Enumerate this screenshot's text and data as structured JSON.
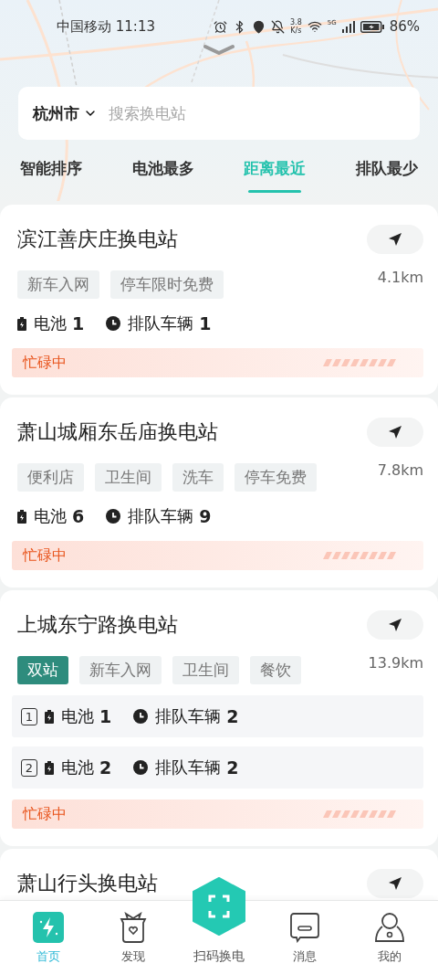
{
  "status_bar": {
    "carrier_time": "中国移动 11:13",
    "speed_value": "3.8",
    "speed_unit": "K/s",
    "network": "5G",
    "battery": "86%"
  },
  "search": {
    "city": "杭州市",
    "placeholder": "搜索换电站"
  },
  "sort_tabs": [
    {
      "label": "智能排序",
      "selected": false
    },
    {
      "label": "电池最多",
      "selected": false
    },
    {
      "label": "距离最近",
      "selected": true
    },
    {
      "label": "排队最少",
      "selected": false
    }
  ],
  "stations": [
    {
      "name": "滨江善庆庄换电站",
      "distance": "4.1km",
      "tags": [
        {
          "label": "新车入网",
          "kind": "normal"
        },
        {
          "label": "停车限时免费",
          "kind": "normal"
        }
      ],
      "bays": [
        {
          "battery_label": "电池",
          "battery_count": "1",
          "queue_label": "排队车辆",
          "queue_count": "1"
        }
      ],
      "status": "忙碌中"
    },
    {
      "name": "萧山城厢东岳庙换电站",
      "distance": "7.8km",
      "tags": [
        {
          "label": "便利店",
          "kind": "normal"
        },
        {
          "label": "卫生间",
          "kind": "normal"
        },
        {
          "label": "洗车",
          "kind": "normal"
        },
        {
          "label": "停车免费",
          "kind": "normal"
        }
      ],
      "bays": [
        {
          "battery_label": "电池",
          "battery_count": "6",
          "queue_label": "排队车辆",
          "queue_count": "9"
        }
      ],
      "status": "忙碌中"
    },
    {
      "name": "上城东宁路换电站",
      "distance": "13.9km",
      "tags": [
        {
          "label": "双站",
          "kind": "highlight"
        },
        {
          "label": "新车入网",
          "kind": "normal"
        },
        {
          "label": "卫生间",
          "kind": "normal"
        },
        {
          "label": "餐饮",
          "kind": "normal"
        }
      ],
      "bays": [
        {
          "index": "1",
          "battery_label": "电池",
          "battery_count": "1",
          "queue_label": "排队车辆",
          "queue_count": "2"
        },
        {
          "index": "2",
          "battery_label": "电池",
          "battery_count": "2",
          "queue_label": "排队车辆",
          "queue_count": "2"
        }
      ],
      "status": "忙碌中"
    },
    {
      "name": "萧山行头换电站"
    }
  ],
  "bottom_nav": [
    {
      "label": "首页",
      "kind": "home",
      "selected": true
    },
    {
      "label": "发现",
      "kind": "discover",
      "selected": false
    },
    {
      "label": "扫码换电",
      "kind": "scan",
      "selected": false
    },
    {
      "label": "消息",
      "kind": "message",
      "selected": false
    },
    {
      "label": "我的",
      "kind": "profile",
      "selected": false
    }
  ]
}
